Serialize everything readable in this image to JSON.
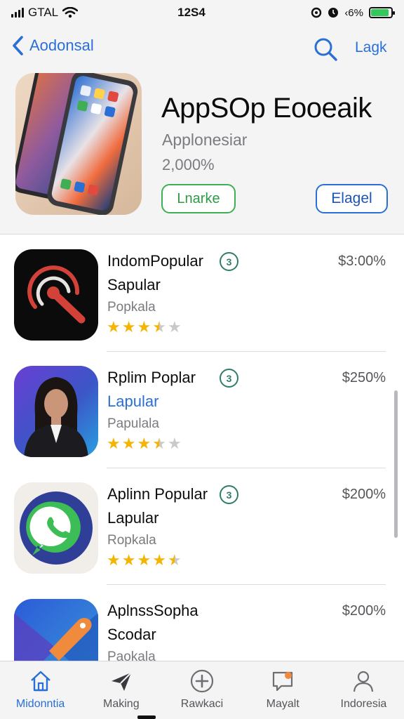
{
  "status_bar": {
    "carrier": "GTAL",
    "time": "12S4",
    "battery_text": "‹6%",
    "battery_level": 0.9
  },
  "nav": {
    "back_label": "Aodonsal",
    "right_label": "Lagk"
  },
  "hero": {
    "title": "AppSOp Eooeaik",
    "subtitle": "Applonesiar",
    "meta": "2,000%",
    "primary_button": "Lnarke",
    "secondary_button": "Elagel"
  },
  "apps": [
    {
      "name": "IndomPopular",
      "badge": "3",
      "subtitle": "Sapular",
      "category": "Popkala",
      "price": "$3:00%",
      "rating": 3.5
    },
    {
      "name": "Rplim Poplar",
      "badge": "3",
      "subtitle": "Lapular",
      "category": "Papulala",
      "price": "$250%",
      "rating": 3.5
    },
    {
      "name": "Aplinn Popular",
      "badge": "3",
      "subtitle": "Lapular",
      "category": "Ropkala",
      "price": "$200%",
      "rating": 4.5
    },
    {
      "name": "AplnssSopha",
      "subtitle": "Scodar",
      "category": "Paokala",
      "price": "$200%"
    }
  ],
  "tabs": [
    {
      "label": "Midonntia",
      "icon": "home-icon"
    },
    {
      "label": "Making",
      "icon": "paper-plane-icon"
    },
    {
      "label": "Rawkaci",
      "icon": "plus-circle-icon"
    },
    {
      "label": "Mayalt",
      "icon": "message-icon"
    },
    {
      "label": "Indoresia",
      "icon": "person-icon"
    }
  ],
  "colors": {
    "accent": "#2a6fd6",
    "green": "#3fae55",
    "star": "#f4b400",
    "badge": "#2e7d6a"
  }
}
